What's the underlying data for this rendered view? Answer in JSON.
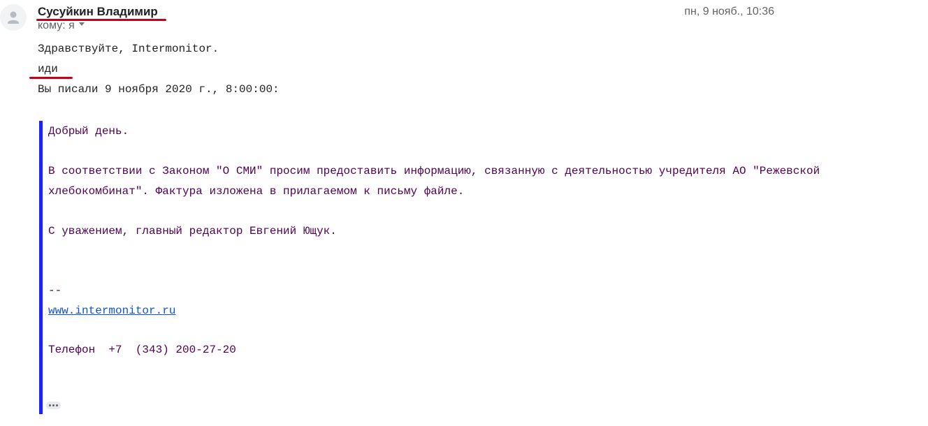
{
  "message": {
    "sender_name": "Сусуйкин Владимир",
    "date": "пн, 9 нояб., 10:36",
    "to_label": "кому: я"
  },
  "body": {
    "greeting": "Здравствуйте, Intermonitor.",
    "reply": "иди",
    "quote_header": "Вы писали 9 ноября 2020 г., 8:00:00:"
  },
  "quote": {
    "line1": "Добрый день.",
    "line2": "В соответствии с Законом \"О СМИ\" просим предоставить информацию, связанную с деятельностью учредителя АО \"Режевской",
    "line3": "хлебокомбинат\". Фактура изложена в прилагаемом к письму файле.",
    "line4": "С уважением, главный редактор Евгений Ющук.",
    "sig_sep": "--",
    "link": "www.intermonitor.ru",
    "phone": "Телефон  +7  (343) 200-27-20"
  },
  "icons": {
    "avatar": "person-icon",
    "caret": "caret-down-icon",
    "more": "ellipsis-icon"
  },
  "colors": {
    "underline": "#c4001a",
    "quote_bar": "#1a22ff",
    "quote_text": "#500050",
    "link": "#1155cc"
  }
}
